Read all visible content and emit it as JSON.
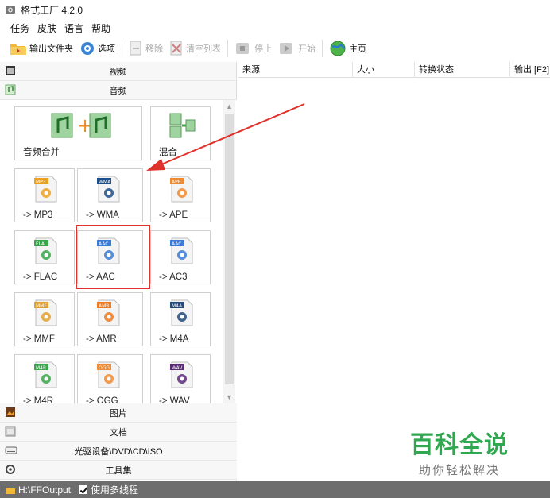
{
  "window": {
    "title": "格式工厂 4.2.0"
  },
  "menu": [
    "任务",
    "皮肤",
    "语言",
    "帮助"
  ],
  "toolbar": {
    "output_folder": "输出文件夹",
    "options": "选项",
    "remove": "移除",
    "clear_list": "清空列表",
    "stop": "停止",
    "start": "开始",
    "home": "主页"
  },
  "categories": {
    "video": "视频",
    "audio": "音频",
    "picture": "图片",
    "document": "文档",
    "rom": "光驱设备\\DVD\\CD\\ISO",
    "tools": "工具集"
  },
  "tiles": [
    {
      "label": "音频合并",
      "icon": "merge-audio-icon"
    },
    {
      "label": "混合",
      "icon": "mix-audio-icon"
    },
    {
      "label": "-> MP3",
      "icon": "mp3-icon",
      "badge": "MP3",
      "color": "#f0a020"
    },
    {
      "label": "-> WMA",
      "icon": "wma-icon",
      "badge": "WMA",
      "color": "#1d4f8c"
    },
    {
      "label": "-> APE",
      "icon": "ape-icon",
      "badge": "APE",
      "color": "#f08a30"
    },
    {
      "label": "-> FLAC",
      "icon": "flac-icon",
      "badge": "FLA",
      "color": "#3aa54a"
    },
    {
      "label": "-> AAC",
      "icon": "aac-icon",
      "badge": "AAC",
      "color": "#3a7bd5"
    },
    {
      "label": "-> AC3",
      "icon": "ac3-icon",
      "badge": "AAC",
      "color": "#3a7bd5"
    },
    {
      "label": "-> MMF",
      "icon": "mmf-icon",
      "badge": "MMF",
      "color": "#e0a030"
    },
    {
      "label": "-> AMR",
      "icon": "amr-icon",
      "badge": "AMR",
      "color": "#f07a20"
    },
    {
      "label": "-> M4A",
      "icon": "m4a-icon",
      "badge": "M4A",
      "color": "#234a7a"
    },
    {
      "label": "-> M4R",
      "icon": "m4r-icon",
      "badge": "M4R",
      "color": "#3aa54a"
    },
    {
      "label": "-> OGG",
      "icon": "ogg-icon",
      "badge": "OGG",
      "color": "#f08a30"
    },
    {
      "label": "-> WAV",
      "icon": "wav-icon",
      "badge": "WAV",
      "color": "#5a2a7a"
    }
  ],
  "table": {
    "columns": [
      "来源",
      "大小",
      "转换状态",
      "输出 [F2]"
    ]
  },
  "watermark": {
    "main": "百科全说",
    "sub": "助你轻松解决"
  },
  "status": {
    "path": "H:\\FFOutput",
    "multithread": "使用多线程"
  },
  "colors": {
    "highlight": "#e0312a",
    "watermark": "#2fa84f",
    "statusbar": "#6d6d6d"
  }
}
